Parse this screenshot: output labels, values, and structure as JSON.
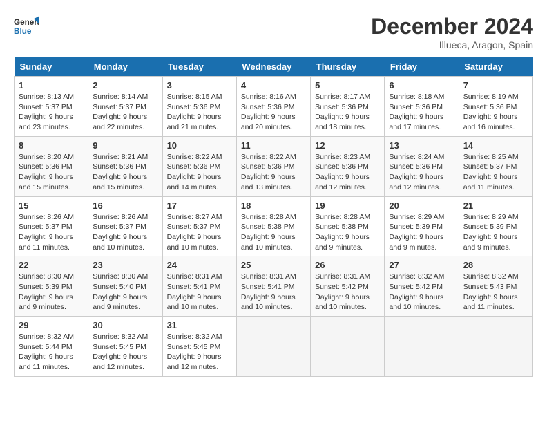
{
  "header": {
    "logo_line1": "General",
    "logo_line2": "Blue",
    "month": "December 2024",
    "location": "Illueca, Aragon, Spain"
  },
  "days_of_week": [
    "Sunday",
    "Monday",
    "Tuesday",
    "Wednesday",
    "Thursday",
    "Friday",
    "Saturday"
  ],
  "weeks": [
    [
      {
        "day": "1",
        "sunrise": "8:13 AM",
        "sunset": "5:37 PM",
        "daylight": "9 hours and 23 minutes."
      },
      {
        "day": "2",
        "sunrise": "8:14 AM",
        "sunset": "5:37 PM",
        "daylight": "9 hours and 22 minutes."
      },
      {
        "day": "3",
        "sunrise": "8:15 AM",
        "sunset": "5:36 PM",
        "daylight": "9 hours and 21 minutes."
      },
      {
        "day": "4",
        "sunrise": "8:16 AM",
        "sunset": "5:36 PM",
        "daylight": "9 hours and 20 minutes."
      },
      {
        "day": "5",
        "sunrise": "8:17 AM",
        "sunset": "5:36 PM",
        "daylight": "9 hours and 18 minutes."
      },
      {
        "day": "6",
        "sunrise": "8:18 AM",
        "sunset": "5:36 PM",
        "daylight": "9 hours and 17 minutes."
      },
      {
        "day": "7",
        "sunrise": "8:19 AM",
        "sunset": "5:36 PM",
        "daylight": "9 hours and 16 minutes."
      }
    ],
    [
      {
        "day": "8",
        "sunrise": "8:20 AM",
        "sunset": "5:36 PM",
        "daylight": "9 hours and 15 minutes."
      },
      {
        "day": "9",
        "sunrise": "8:21 AM",
        "sunset": "5:36 PM",
        "daylight": "9 hours and 15 minutes."
      },
      {
        "day": "10",
        "sunrise": "8:22 AM",
        "sunset": "5:36 PM",
        "daylight": "9 hours and 14 minutes."
      },
      {
        "day": "11",
        "sunrise": "8:22 AM",
        "sunset": "5:36 PM",
        "daylight": "9 hours and 13 minutes."
      },
      {
        "day": "12",
        "sunrise": "8:23 AM",
        "sunset": "5:36 PM",
        "daylight": "9 hours and 12 minutes."
      },
      {
        "day": "13",
        "sunrise": "8:24 AM",
        "sunset": "5:36 PM",
        "daylight": "9 hours and 12 minutes."
      },
      {
        "day": "14",
        "sunrise": "8:25 AM",
        "sunset": "5:37 PM",
        "daylight": "9 hours and 11 minutes."
      }
    ],
    [
      {
        "day": "15",
        "sunrise": "8:26 AM",
        "sunset": "5:37 PM",
        "daylight": "9 hours and 11 minutes."
      },
      {
        "day": "16",
        "sunrise": "8:26 AM",
        "sunset": "5:37 PM",
        "daylight": "9 hours and 10 minutes."
      },
      {
        "day": "17",
        "sunrise": "8:27 AM",
        "sunset": "5:37 PM",
        "daylight": "9 hours and 10 minutes."
      },
      {
        "day": "18",
        "sunrise": "8:28 AM",
        "sunset": "5:38 PM",
        "daylight": "9 hours and 10 minutes."
      },
      {
        "day": "19",
        "sunrise": "8:28 AM",
        "sunset": "5:38 PM",
        "daylight": "9 hours and 9 minutes."
      },
      {
        "day": "20",
        "sunrise": "8:29 AM",
        "sunset": "5:39 PM",
        "daylight": "9 hours and 9 minutes."
      },
      {
        "day": "21",
        "sunrise": "8:29 AM",
        "sunset": "5:39 PM",
        "daylight": "9 hours and 9 minutes."
      }
    ],
    [
      {
        "day": "22",
        "sunrise": "8:30 AM",
        "sunset": "5:39 PM",
        "daylight": "9 hours and 9 minutes."
      },
      {
        "day": "23",
        "sunrise": "8:30 AM",
        "sunset": "5:40 PM",
        "daylight": "9 hours and 9 minutes."
      },
      {
        "day": "24",
        "sunrise": "8:31 AM",
        "sunset": "5:41 PM",
        "daylight": "9 hours and 10 minutes."
      },
      {
        "day": "25",
        "sunrise": "8:31 AM",
        "sunset": "5:41 PM",
        "daylight": "9 hours and 10 minutes."
      },
      {
        "day": "26",
        "sunrise": "8:31 AM",
        "sunset": "5:42 PM",
        "daylight": "9 hours and 10 minutes."
      },
      {
        "day": "27",
        "sunrise": "8:32 AM",
        "sunset": "5:42 PM",
        "daylight": "9 hours and 10 minutes."
      },
      {
        "day": "28",
        "sunrise": "8:32 AM",
        "sunset": "5:43 PM",
        "daylight": "9 hours and 11 minutes."
      }
    ],
    [
      {
        "day": "29",
        "sunrise": "8:32 AM",
        "sunset": "5:44 PM",
        "daylight": "9 hours and 11 minutes."
      },
      {
        "day": "30",
        "sunrise": "8:32 AM",
        "sunset": "5:45 PM",
        "daylight": "9 hours and 12 minutes."
      },
      {
        "day": "31",
        "sunrise": "8:32 AM",
        "sunset": "5:45 PM",
        "daylight": "9 hours and 12 minutes."
      },
      null,
      null,
      null,
      null
    ]
  ]
}
